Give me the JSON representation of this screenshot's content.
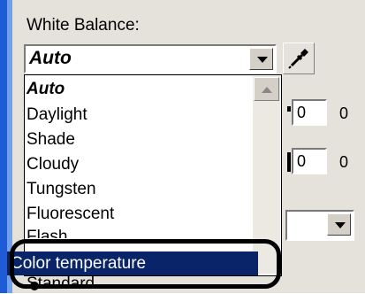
{
  "white_balance": {
    "title": "White Balance:",
    "selected_value": "Auto",
    "options": [
      "Auto",
      "Daylight",
      "Shade",
      "Cloudy",
      "Tungsten",
      "Fluorescent",
      "Flash",
      "Color temperature"
    ],
    "highlighted_option": "Color temperature"
  },
  "fields": {
    "value1": "0",
    "value1_tail": "0",
    "value2": "0",
    "value2_tail": "0"
  },
  "partial_text": {
    "standard": "Standard"
  },
  "icons": [
    "dropdown-arrow-icon",
    "eyedropper-icon",
    "scroll-up-icon",
    "radio-dot-icon"
  ],
  "colors": {
    "selection": "#0a246a",
    "rail": "#1e5bd6",
    "panel": "#e4e2db"
  }
}
